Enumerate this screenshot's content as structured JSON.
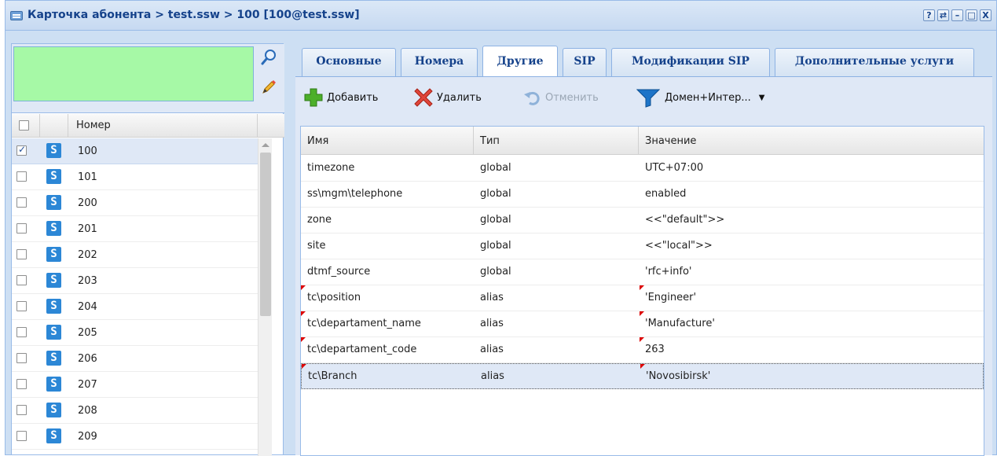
{
  "window": {
    "title": "Карточка абонента > test.ssw > 100 [100@test.ssw]",
    "tools": [
      "?",
      "⇄",
      "–",
      "□",
      "X"
    ]
  },
  "left_panel": {
    "list_header": "Номер",
    "rows": [
      {
        "number": "100",
        "checked": true
      },
      {
        "number": "101",
        "checked": false
      },
      {
        "number": "200",
        "checked": false
      },
      {
        "number": "201",
        "checked": false
      },
      {
        "number": "202",
        "checked": false
      },
      {
        "number": "203",
        "checked": false
      },
      {
        "number": "204",
        "checked": false
      },
      {
        "number": "205",
        "checked": false
      },
      {
        "number": "206",
        "checked": false
      },
      {
        "number": "207",
        "checked": false
      },
      {
        "number": "208",
        "checked": false
      },
      {
        "number": "209",
        "checked": false
      }
    ],
    "row_icon": "S"
  },
  "tabs": [
    {
      "label": "Основные"
    },
    {
      "label": "Номера"
    },
    {
      "label": "Другие"
    },
    {
      "label": "SIP"
    },
    {
      "label": "Модификации SIP"
    },
    {
      "label": "Дополнительные услуги"
    }
  ],
  "active_tab": "Другие",
  "toolbar": {
    "add_label": "Добавить",
    "delete_label": "Удалить",
    "cancel_label": "Отменить",
    "filter_label": "Домен+Интер..."
  },
  "grid": {
    "columns": [
      "Имя",
      "Тип",
      "Значение"
    ],
    "rows": [
      {
        "name": "timezone",
        "type": "global",
        "value": "UTC+07:00",
        "modified": false
      },
      {
        "name": "ss\\mgm\\telephone",
        "type": "global",
        "value": "enabled",
        "modified": false
      },
      {
        "name": "zone",
        "type": "global",
        "value": "<<\"default\">>",
        "modified": false
      },
      {
        "name": "site",
        "type": "global",
        "value": "<<\"local\">>",
        "modified": false
      },
      {
        "name": "dtmf_source",
        "type": "global",
        "value": "'rfc+info'",
        "modified": false
      },
      {
        "name": "tc\\position",
        "type": "alias",
        "value": "'Engineer'",
        "modified": true
      },
      {
        "name": "tc\\departament_name",
        "type": "alias",
        "value": "'Manufacture'",
        "modified": true
      },
      {
        "name": "tc\\departament_code",
        "type": "alias",
        "value": "263",
        "modified": true
      },
      {
        "name": "tc\\Branch",
        "type": "alias",
        "value": "'Novosibirsk'",
        "modified": true,
        "selected": true
      }
    ]
  },
  "colors": {
    "accent": "#15428b",
    "search_box": "#a6f9a6",
    "row_icon": "#2c87d6",
    "dirty_marker": "#dd0000"
  }
}
